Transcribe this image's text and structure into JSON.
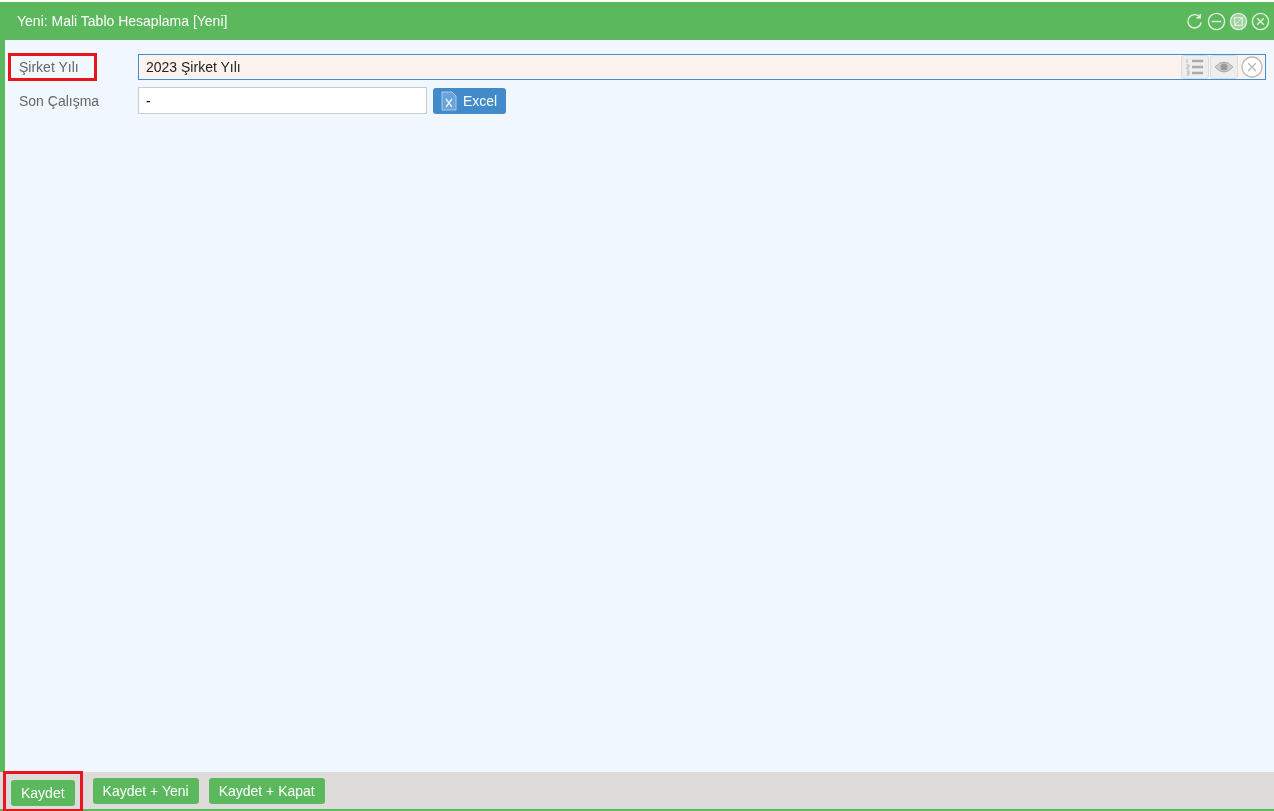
{
  "window": {
    "title": "Yeni: Mali Tablo Hesaplama [Yeni]"
  },
  "fields": [
    {
      "kind": "lookup",
      "label": "Şirket Yılı",
      "value": "2023 Şirket Yılı",
      "highlighted": true
    },
    {
      "kind": "text",
      "label": "Son Çalışma",
      "value": "-",
      "highlighted": false,
      "button": "Excel"
    }
  ],
  "buttons": [
    {
      "label": "Kaydet",
      "highlighted": true
    },
    {
      "label": "Kaydet + Yeni",
      "highlighted": false
    },
    {
      "label": "Kaydet + Kapat",
      "highlighted": false
    }
  ]
}
